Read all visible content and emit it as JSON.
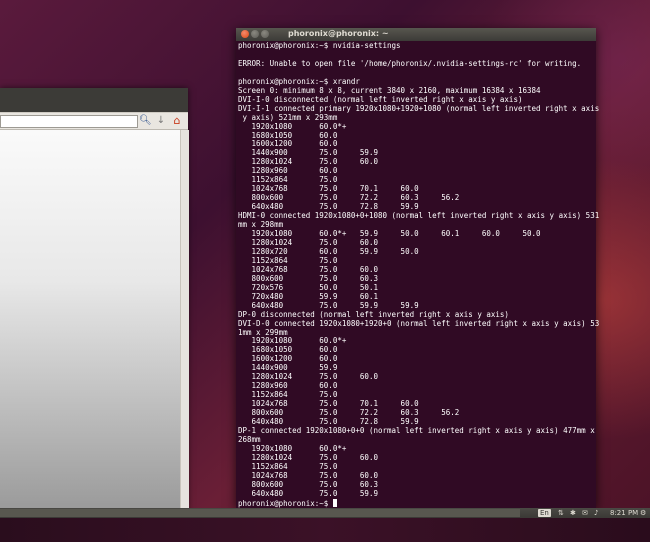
{
  "terminal": {
    "title": "phoronix@phoronix: ~",
    "lines": [
      "phoronix@phoronix:~$ nvidia-settings",
      "",
      "ERROR: Unable to open file '/home/phoronix/.nvidia-settings-rc' for writing.",
      "",
      "phoronix@phoronix:~$ xrandr",
      "Screen 0: minimum 8 x 8, current 3840 x 2160, maximum 16384 x 16384",
      "DVI-I-0 disconnected (normal left inverted right x axis y axis)",
      "DVI-I-1 connected primary 1920x1080+1920+1080 (normal left inverted right x axis",
      " y axis) 521mm x 293mm",
      "   1920x1080      60.0*+",
      "   1680x1050      60.0",
      "   1600x1200      60.0",
      "   1440x900       75.0     59.9",
      "   1280x1024      75.0     60.0",
      "   1280x960       60.0",
      "   1152x864       75.0",
      "   1024x768       75.0     70.1     60.0",
      "   800x600        75.0     72.2     60.3     56.2",
      "   640x480        75.0     72.8     59.9",
      "HDMI-0 connected 1920x1080+0+1080 (normal left inverted right x axis y axis) 531",
      "mm x 298mm",
      "   1920x1080      60.0*+   59.9     50.0     60.1     60.0     50.0",
      "   1280x1024      75.0     60.0",
      "   1280x720       60.0     59.9     50.0",
      "   1152x864       75.0",
      "   1024x768       75.0     60.0",
      "   800x600        75.0     60.3",
      "   720x576        50.0     50.1",
      "   720x480        59.9     60.1",
      "   640x480        75.0     59.9     59.9",
      "DP-0 disconnected (normal left inverted right x axis y axis)",
      "DVI-D-0 connected 1920x1080+1920+0 (normal left inverted right x axis y axis) 53",
      "1mm x 299mm",
      "   1920x1080      60.0*+",
      "   1680x1050      60.0",
      "   1600x1200      60.0",
      "   1440x900       59.9",
      "   1280x1024      75.0     60.0",
      "   1280x960       60.0",
      "   1152x864       75.0",
      "   1024x768       75.0     70.1     60.0",
      "   800x600        75.0     72.2     60.3     56.2",
      "   640x480        75.0     72.8     59.9",
      "DP-1 connected 1920x1080+0+0 (normal left inverted right x axis y axis) 477mm x",
      "268mm",
      "   1920x1080      60.0*+",
      "   1280x1024      75.0     60.0",
      "   1152x864       75.0",
      "   1024x768       75.0     60.0",
      "   800x600        75.0     60.3",
      "   640x480        75.0     59.9"
    ],
    "prompt": "phoronix@phoronix:~$ "
  },
  "browser": {
    "search_icon": "magnifier-icon",
    "download_icon": "download-arrow-icon",
    "home_icon": "home-icon"
  },
  "tray": {
    "keyboard": "En",
    "time": "8:21 PM"
  }
}
